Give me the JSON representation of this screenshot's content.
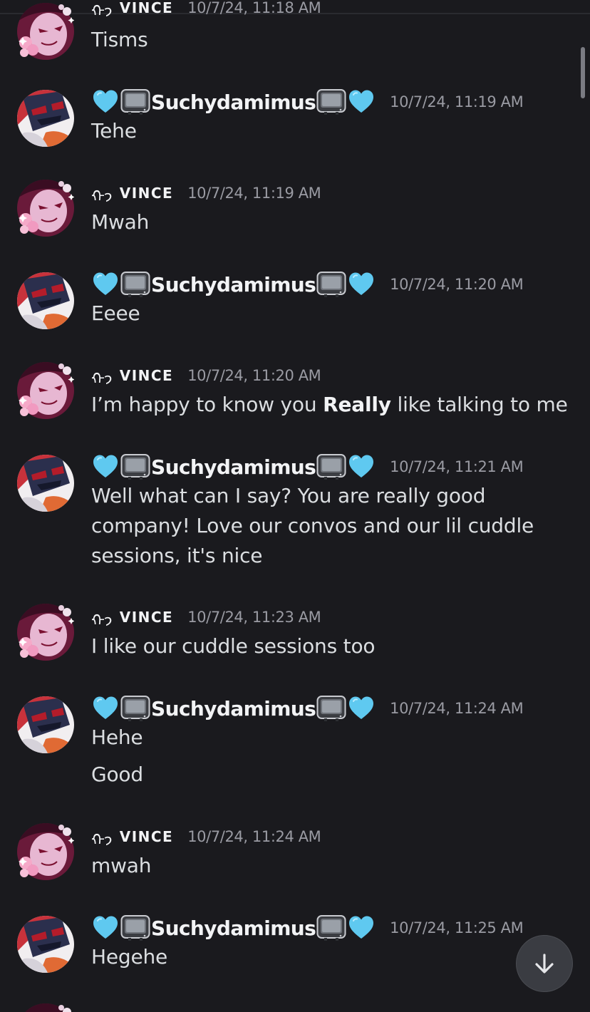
{
  "partial_top": {
    "time": "10/7/24, 11:18 AM",
    "text": "Tisms"
  },
  "users": {
    "suchy": {
      "name": "Suchydamimus"
    },
    "vince": {
      "prefix": "ᡣ𐭩",
      "name": "VINCE"
    }
  },
  "messages": [
    {
      "author": "suchy",
      "time": "10/7/24, 11:19 AM",
      "lines": [
        "Tehe"
      ]
    },
    {
      "author": "vince",
      "time": "10/7/24, 11:19 AM",
      "lines": [
        "Mwah"
      ]
    },
    {
      "author": "suchy",
      "time": "10/7/24, 11:20 AM",
      "lines": [
        "Eeee"
      ]
    },
    {
      "author": "vince",
      "time": "10/7/24, 11:20 AM",
      "lines": [
        "I’m happy to know you ",
        "Really",
        " like talking to me"
      ]
    },
    {
      "author": "suchy",
      "time": "10/7/24, 11:21 AM",
      "lines": [
        "Well what can I say? You are really good company! Love our convos and our lil cuddle sessions, it's nice"
      ]
    },
    {
      "author": "vince",
      "time": "10/7/24, 11:23 AM",
      "lines": [
        "I like our cuddle sessions too"
      ]
    },
    {
      "author": "suchy",
      "time": "10/7/24, 11:24 AM",
      "lines": [
        "Hehe",
        "Good"
      ]
    },
    {
      "author": "vince",
      "time": "10/7/24, 11:24 AM",
      "lines": [
        "mwah"
      ]
    },
    {
      "author": "suchy",
      "time": "10/7/24, 11:25 AM",
      "lines": [
        "Hegehe"
      ]
    }
  ],
  "icons": {
    "heart": "light-blue-heart-icon",
    "tv": "television-icon",
    "scroll": "arrow-down-icon"
  },
  "colors": {
    "background": "#1a1a1e",
    "text": "#dbdee1",
    "timestamp": "#9a9ba3",
    "heart": "#5fc9f0"
  }
}
